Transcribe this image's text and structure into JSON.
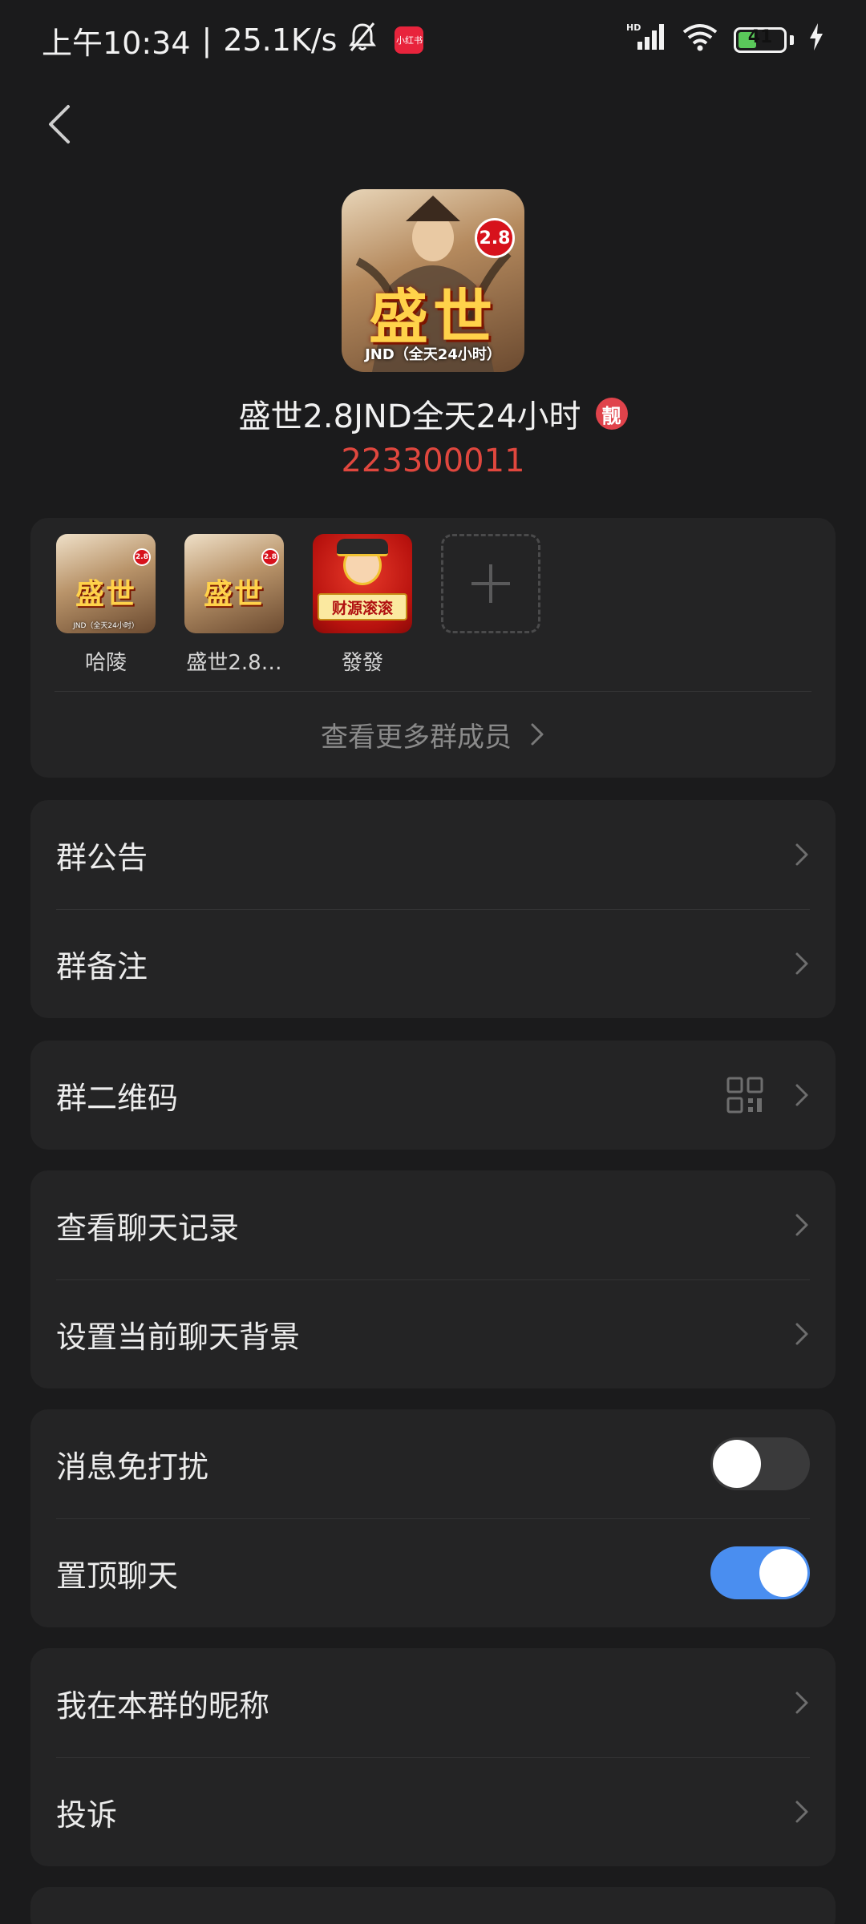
{
  "status_bar": {
    "time": "上午10:34",
    "speed": "25.1K/s",
    "app_badge": "小红书",
    "network": "HD",
    "battery": "41"
  },
  "group": {
    "name": "盛世2.8JND全天24小时",
    "liang_badge": "靓",
    "id": "223300011",
    "avatar_title": "盛世",
    "avatar_badge": "2.8",
    "avatar_subtitle": "JND（全天24小时）"
  },
  "members": {
    "items": [
      {
        "name": "哈陵",
        "avatar_title": "盛世",
        "avatar_badge": "2.8",
        "avatar_subtitle": "JND（全天24小时）"
      },
      {
        "name": "盛世2.8…",
        "avatar_title": "盛世",
        "avatar_badge": "2.8",
        "avatar_subtitle": ""
      },
      {
        "name": "發發",
        "avatar_banner": "财源滚滚"
      }
    ],
    "more_label": "查看更多群成员"
  },
  "settings": {
    "announcement": "群公告",
    "remark": "群备注",
    "qr_code": "群二维码",
    "chat_history": "查看聊天记录",
    "chat_background": "设置当前聊天背景",
    "mute": "消息免打扰",
    "mute_on": false,
    "pin": "置顶聊天",
    "pin_on": true,
    "nickname": "我在本群的昵称",
    "report": "投诉"
  },
  "colors": {
    "accent": "#4a8ef0",
    "id_red": "#e0473e",
    "background": "#1b1b1c",
    "card": "#242425"
  }
}
